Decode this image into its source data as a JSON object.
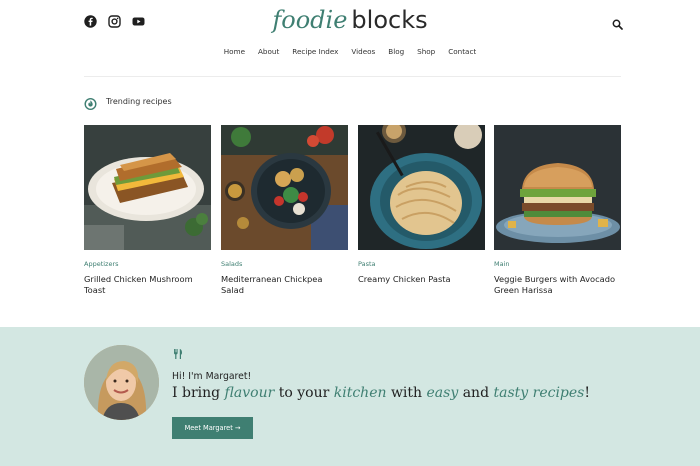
{
  "header": {
    "logo_script": "foodie",
    "logo_text": "blocks",
    "social": [
      "facebook-icon",
      "instagram-icon",
      "youtube-icon"
    ],
    "search_icon": "search-icon"
  },
  "nav": {
    "items": [
      {
        "label": "Home"
      },
      {
        "label": "About"
      },
      {
        "label": "Recipe Index"
      },
      {
        "label": "Videos"
      },
      {
        "label": "Blog"
      },
      {
        "label": "Shop"
      },
      {
        "label": "Contact"
      }
    ]
  },
  "trending": {
    "label": "Trending recipes",
    "icon": "flame-icon",
    "cards": [
      {
        "category": "Appetizers",
        "title": "Grilled Chicken Mushroom Toast"
      },
      {
        "category": "Salads",
        "title": "Mediterranean Chickpea Salad"
      },
      {
        "category": "Pasta",
        "title": "Creamy Chicken Pasta"
      },
      {
        "category": "Main",
        "title": "Veggie Burgers with Avocado Green Harissa"
      }
    ]
  },
  "about": {
    "icon": "fork-knife-icon",
    "greeting": "Hi! I'm Margaret!",
    "tag_1": "I bring",
    "tag_2": "flavour",
    "tag_3": "to your",
    "tag_4": "kitchen",
    "tag_5": "with",
    "tag_6": "easy",
    "tag_7": "and",
    "tag_8": "tasty recipes",
    "tag_9": "!",
    "button": "Meet Margaret →"
  },
  "colors": {
    "accent": "#3f7f72",
    "band": "#d3e7e2",
    "text": "#1f1f1f"
  }
}
